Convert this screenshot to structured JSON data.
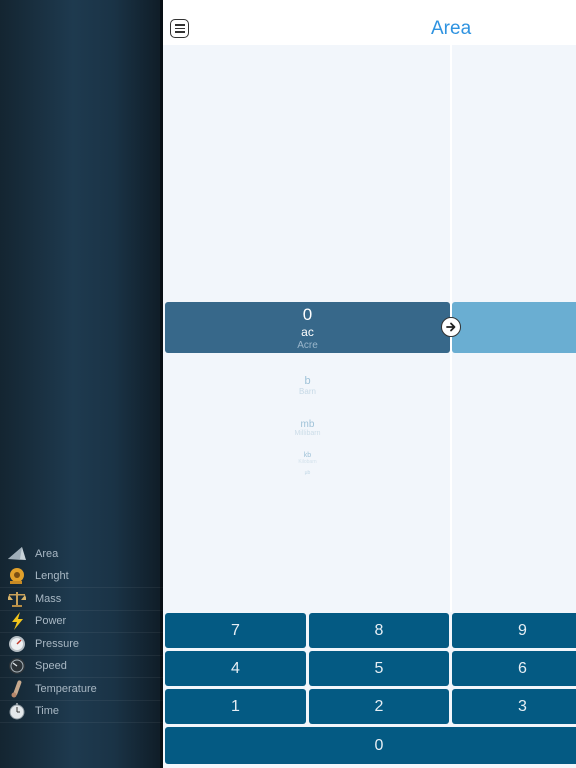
{
  "header": {
    "title": "Area"
  },
  "converter": {
    "value": "0",
    "from_abbr": "ac",
    "from_name": "Acre",
    "picker": [
      {
        "abbr": "b",
        "name": "Barn"
      },
      {
        "abbr": "mb",
        "name": "Millibarn"
      },
      {
        "abbr": "kb",
        "name": "Kilobarn"
      },
      {
        "abbr": "μb",
        "name": ""
      }
    ]
  },
  "sidebar": {
    "items": [
      {
        "label": "Area",
        "icon": "area-icon"
      },
      {
        "label": "Lenght",
        "icon": "length-icon"
      },
      {
        "label": "Mass",
        "icon": "scale-icon"
      },
      {
        "label": "Power",
        "icon": "lightning-icon"
      },
      {
        "label": "Pressure",
        "icon": "gauge-icon"
      },
      {
        "label": "Speed",
        "icon": "speedometer-icon"
      },
      {
        "label": "Temperature",
        "icon": "thermometer-icon"
      },
      {
        "label": "Time",
        "icon": "clock-icon"
      }
    ]
  },
  "keypad": {
    "k7": "7",
    "k8": "8",
    "k9": "9",
    "k4": "4",
    "k5": "5",
    "k6": "6",
    "k1": "1",
    "k2": "2",
    "k3": "3",
    "k0": "0"
  },
  "colors": {
    "accent": "#2f93e0",
    "selected_left": "#37688a",
    "selected_right": "#6aaed2",
    "key": "#045a83"
  }
}
